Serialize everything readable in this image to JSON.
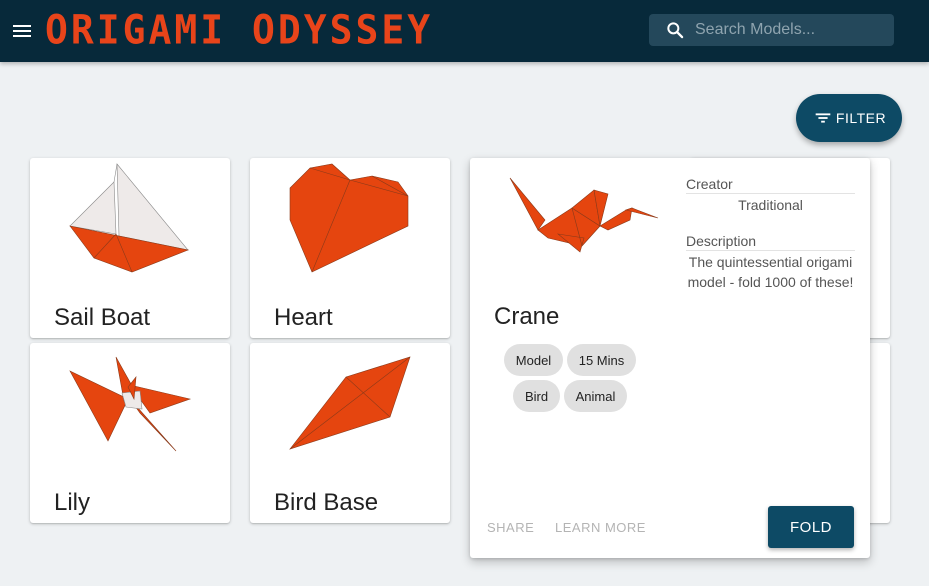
{
  "app": {
    "title": "ORIGAMI ODYSSEY"
  },
  "header": {
    "menu_icon": "hamburger-menu-icon",
    "search_icon": "search-icon",
    "search_placeholder": "Search Models..."
  },
  "filter": {
    "label": "FILTER",
    "icon": "filter-list-icon"
  },
  "colors": {
    "appbar": "#07293a",
    "brand": "#e8441a",
    "paper_orange": "#e5450f",
    "paper_white": "#eeeae9",
    "primary_button": "#0d4a65"
  },
  "models": [
    {
      "name": "Sail Boat"
    },
    {
      "name": "Heart"
    },
    {
      "name": "Lily"
    },
    {
      "name": "Bird Base"
    }
  ],
  "detail": {
    "name": "Crane",
    "tags": [
      "Model",
      "15 Mins",
      "Bird",
      "Animal"
    ],
    "creator_label": "Creator",
    "creator": "Traditional",
    "description_label": "Description",
    "description": "The quintessential origami model - fold 1000 of these!",
    "share_label": "SHARE",
    "learn_more_label": "LEARN MORE",
    "fold_label": "FOLD"
  }
}
